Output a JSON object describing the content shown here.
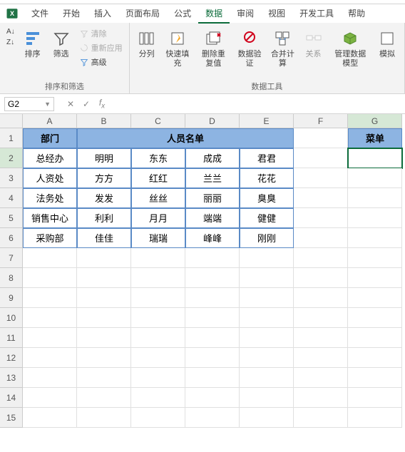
{
  "menu": [
    "文件",
    "开始",
    "插入",
    "页面布局",
    "公式",
    "数据",
    "审阅",
    "视图",
    "开发工具",
    "帮助"
  ],
  "active_menu": 5,
  "ribbon": {
    "group1": {
      "sort_asc": "AZ↓",
      "sort_desc": "ZA↓",
      "sort": "排序",
      "filter": "筛选",
      "clear": "清除",
      "reapply": "重新应用",
      "advanced": "高级",
      "label": "排序和筛选"
    },
    "group2": {
      "text_to_cols": "分列",
      "flash_fill": "快速填充",
      "remove_dup": "删除重复值",
      "validation": "数据验证",
      "consolidate": "合并计算",
      "relations": "关系",
      "data_model": "管理数据模型",
      "sim": "模拟",
      "label": "数据工具"
    }
  },
  "namebox": "G2",
  "columns": [
    "A",
    "B",
    "C",
    "D",
    "E",
    "F",
    "G"
  ],
  "selected_col": 6,
  "selected_row": 1,
  "row_count": 15,
  "headers": {
    "dept": "部门",
    "list": "人员名单",
    "menu": "菜单"
  },
  "table": [
    [
      "总经办",
      "明明",
      "东东",
      "成成",
      "君君"
    ],
    [
      "人资处",
      "方方",
      "红红",
      "兰兰",
      "花花"
    ],
    [
      "法务处",
      "发发",
      "丝丝",
      "丽丽",
      "臭臭"
    ],
    [
      "销售中心",
      "利利",
      "月月",
      "端端",
      "健健"
    ],
    [
      "采购部",
      "佳佳",
      "瑞瑞",
      "峰峰",
      "刚刚"
    ]
  ]
}
